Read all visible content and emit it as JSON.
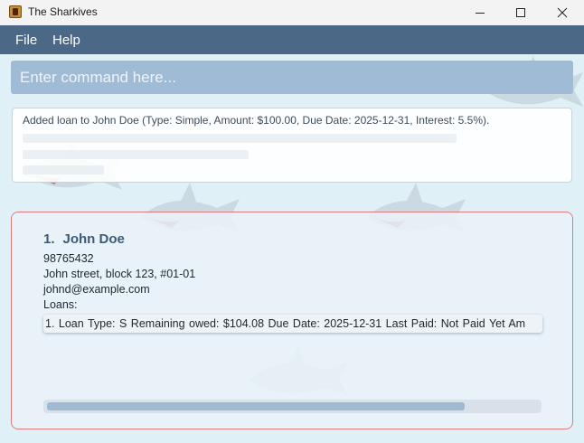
{
  "window": {
    "title": "The Sharkives",
    "icon": "app-book-icon",
    "controls": [
      "minimize-icon",
      "maximize-icon",
      "close-icon"
    ]
  },
  "menu": {
    "file": "File",
    "help": "Help"
  },
  "command": {
    "placeholder": "Enter command here..."
  },
  "result": {
    "message": "Added loan to John Doe (Type: Simple, Amount: $100.00, Due Date: 2025-12-31, Interest: 5.5%)."
  },
  "person": {
    "index": "1.",
    "name": "John Doe",
    "phone": "98765432",
    "address": "John street, block 123, #01-01",
    "email": "johnd@example.com",
    "loans_label": "Loans:",
    "loans": [
      "1. Loan Type: S   Remaining owed: $104.08   Due Date: 2025-12-31   Last Paid: Not Paid Yet   Am"
    ]
  },
  "scrollbar": {
    "visible_fraction": 0.84
  },
  "colors": {
    "menubar": "#4b6987",
    "command_bg": "#9fbbd6",
    "card_border": "#e07a7a",
    "background": "#dff1f7"
  }
}
